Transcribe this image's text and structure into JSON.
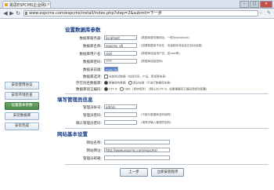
{
  "browser": {
    "tab_title": "易思ESPCMS企业网站管",
    "tab_close": "×",
    "url": "www.espcms.com/espcms/install/index.php?step=2&submit=下一步",
    "controls": {
      "minimize": "–",
      "maximize": "□",
      "close": "×"
    }
  },
  "sidebar": {
    "items": [
      {
        "label": "安装使用协议"
      },
      {
        "label": "安装环境检查"
      },
      {
        "label": "设置基本参数"
      },
      {
        "label": "安装数据库"
      },
      {
        "label": "安装完成"
      }
    ],
    "active_index": 2
  },
  "db_section": {
    "title": "设置数据库参数",
    "fields": [
      {
        "label": "数据库服务器:",
        "value": "localhost",
        "hint": "(数据库服务器地址，一般为localhost)"
      },
      {
        "label": "数据库名称:",
        "value": "espcms_v6",
        "hint": "(如果数据库不存在，安装程序将会尝试自动创建)"
      },
      {
        "label": "数据库用户名:",
        "value": "root",
        "hint": "(数据库连接用户名，如root等)"
      },
      {
        "label": "数据库密码:",
        "value": "****",
        "hint": "(数据库连接密码)"
      },
      {
        "label": "数据表前缀:",
        "value": "espcms",
        "hint": ""
      }
    ],
    "data_option_label": "数据库选项:",
    "data_option_text": "安装测试数据（包括栏目、产品、新闻等信息）",
    "old_data_label": "存在同名数据库:",
    "old_data_options": [
      "覆盖原有数据",
      "跳过安装（不进行数据库安装）"
    ],
    "lang_label": "数据库语言编码:",
    "lang_options": [
      "UTF-8",
      "GBK（请勿修改）"
    ],
    "lang_hint": "(默认为UTF-8，如果需要其它编码请修改配置)"
  },
  "admin_section": {
    "title": "填写管理员信息",
    "fields": [
      {
        "label": "管理员帐号:",
        "value": "admin",
        "hint": ""
      },
      {
        "label": "管理员密码:",
        "value": "",
        "hint": "(不能与数据库密码相同)"
      },
      {
        "label": "确认管理员密码:",
        "value": "",
        "hint": "(请再次输入管理员密码)"
      }
    ]
  },
  "site_section": {
    "title": "网站基本设置",
    "fields": [
      {
        "label": "网站名称:",
        "value": ""
      },
      {
        "label": "网站网址:",
        "value": "http://www.espcms.com/espcms/"
      },
      {
        "label": "管理员邮箱:",
        "value": ""
      }
    ]
  },
  "buttons": {
    "prev": "上一步",
    "next": "立即安装程序"
  }
}
